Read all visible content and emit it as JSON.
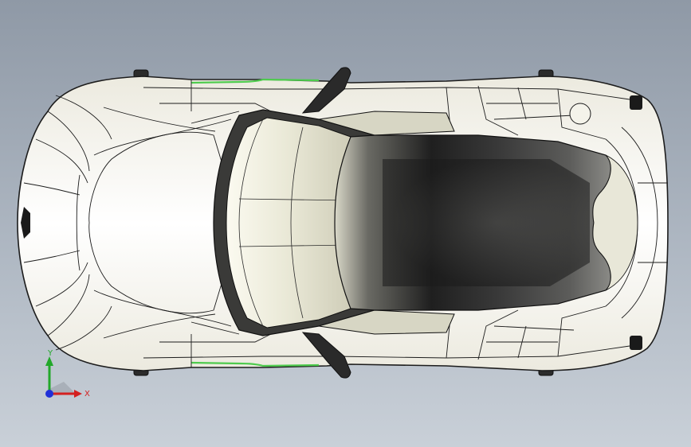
{
  "viewport": {
    "background_top": "#8f99a6",
    "background_bottom": "#c9d0d8"
  },
  "model": {
    "view": "top",
    "body_color": "#f4f3ea",
    "edge_color": "#1c1c1c",
    "accent_color": "#4ecb4e",
    "canopy_color": "#2a2a2a"
  },
  "triad": {
    "x_label": "X",
    "y_label": "Y",
    "x_color": "#d42020",
    "y_color": "#22a82a",
    "z_color": "#2030d8"
  }
}
